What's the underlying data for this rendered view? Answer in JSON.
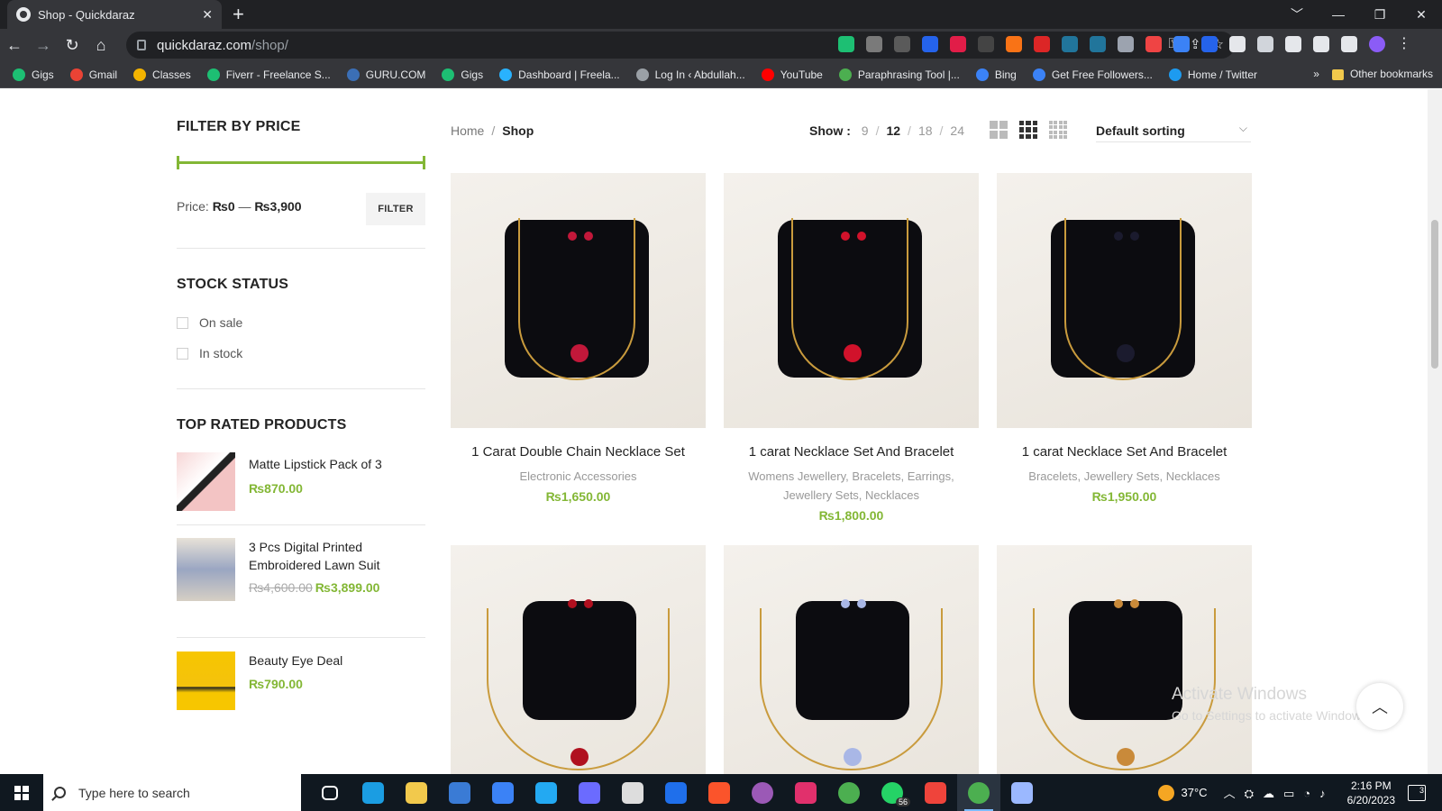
{
  "browser": {
    "tab_title": "Shop - Quickdaraz",
    "tab_close": "✕",
    "new_tab": "+",
    "url_host": "quickdaraz.com",
    "url_path": "/shop/",
    "window_controls": [
      "﹀",
      "—",
      "❐",
      "✕"
    ],
    "bookmarks": [
      {
        "label": "Gigs",
        "color": "#1dbf73"
      },
      {
        "label": "Gmail",
        "color": "#ea4335"
      },
      {
        "label": "Classes",
        "color": "#f4b400"
      },
      {
        "label": "Fiverr - Freelance S...",
        "color": "#1dbf73"
      },
      {
        "label": "GURU.COM",
        "color": "#3b6fb6"
      },
      {
        "label": "Gigs",
        "color": "#1dbf73"
      },
      {
        "label": "Dashboard | Freela...",
        "color": "#29b2fe"
      },
      {
        "label": "Log In ‹ Abdullah...",
        "color": "#9aa0a6"
      },
      {
        "label": "YouTube",
        "color": "#ff0000"
      },
      {
        "label": "Paraphrasing Tool |...",
        "color": "#4caf50"
      },
      {
        "label": "Bing",
        "color": "#3b82f6"
      },
      {
        "label": "Get Free Followers...",
        "color": "#3b82f6"
      },
      {
        "label": "Home / Twitter",
        "color": "#1d9bf0"
      }
    ],
    "bookmarks_overflow": "»",
    "other_bookmarks": "Other bookmarks"
  },
  "sidebar": {
    "filter_by_price": {
      "heading": "FILTER BY PRICE",
      "price_prefix": "Price:",
      "price_min": "₨0",
      "price_sep": "—",
      "price_max": "₨3,900",
      "button": "FILTER"
    },
    "stock_status": {
      "heading": "STOCK STATUS",
      "options": [
        "On sale",
        "In stock"
      ]
    },
    "top_rated": {
      "heading": "TOP RATED PRODUCTS",
      "items": [
        {
          "name": "Matte Lipstick Pack of 3",
          "old_price": "",
          "price": "₨870.00"
        },
        {
          "name": "3 Pcs Digital Printed Embroidered Lawn Suit",
          "old_price": "₨4,600.00",
          "price": "₨3,899.00"
        },
        {
          "name": "Beauty Eye Deal",
          "old_price": "",
          "price": "₨790.00"
        }
      ]
    }
  },
  "toolbar": {
    "breadcrumb_home": "Home",
    "breadcrumb_sep": "/",
    "breadcrumb_current": "Shop",
    "show_label": "Show :",
    "show_options": [
      "9",
      "12",
      "18",
      "24"
    ],
    "show_active": "12",
    "sorting": "Default sorting"
  },
  "products": [
    {
      "name": "1 Carat Double Chain Necklace Set",
      "categories": "Electronic Accessories",
      "price": "₨1,650.00",
      "gem": "#c2183a"
    },
    {
      "name": "1 carat Necklace Set And Bracelet",
      "categories": "Womens Jewellery, Bracelets, Earrings, Jewellery Sets, Necklaces",
      "price": "₨1,800.00",
      "gem": "#d1122b"
    },
    {
      "name": "1 carat Necklace Set And Bracelet",
      "categories": "Bracelets, Jewellery Sets, Necklaces",
      "price": "₨1,950.00",
      "gem": "#1b1b2e"
    },
    {
      "name": "",
      "categories": "",
      "price": "",
      "gem": "#b0101f"
    },
    {
      "name": "",
      "categories": "",
      "price": "",
      "gem": "#a9b7e6"
    },
    {
      "name": "",
      "categories": "",
      "price": "",
      "gem": "#c98a3a"
    }
  ],
  "watermark": {
    "line1": "Activate Windows",
    "line2": "Go to Settings to activate Windows."
  },
  "taskbar": {
    "search_placeholder": "Type here to search",
    "apps": [
      {
        "name": "task-view",
        "color": "#ffffff"
      },
      {
        "name": "edge",
        "color": "#1b9de2"
      },
      {
        "name": "file-explorer",
        "color": "#f2c94c"
      },
      {
        "name": "store",
        "color": "#3a7bd5"
      },
      {
        "name": "mail",
        "color": "#3b82f6"
      },
      {
        "name": "vscode",
        "color": "#23a9f2"
      },
      {
        "name": "power-automate",
        "color": "#6b6bff"
      },
      {
        "name": "app-car",
        "color": "#dddddd"
      },
      {
        "name": "dev",
        "color": "#1f6feb"
      },
      {
        "name": "brave",
        "color": "#fb542b"
      },
      {
        "name": "github",
        "color": "#9b59b6"
      },
      {
        "name": "instagram",
        "color": "#e1306c"
      },
      {
        "name": "chrome",
        "color": "#4caf50"
      },
      {
        "name": "whatsapp",
        "color": "#25d366"
      },
      {
        "name": "anydesk",
        "color": "#ef443b"
      },
      {
        "name": "chrome-active",
        "color": "#4caf50"
      },
      {
        "name": "network-app",
        "color": "#9bb8ff"
      }
    ],
    "whatsapp_badge": "56",
    "temperature": "37°C",
    "time": "2:16 PM",
    "date": "6/20/2023",
    "notifications": "3"
  },
  "colors": {
    "accent": "#83b735",
    "browser_dark": "#35363a"
  }
}
